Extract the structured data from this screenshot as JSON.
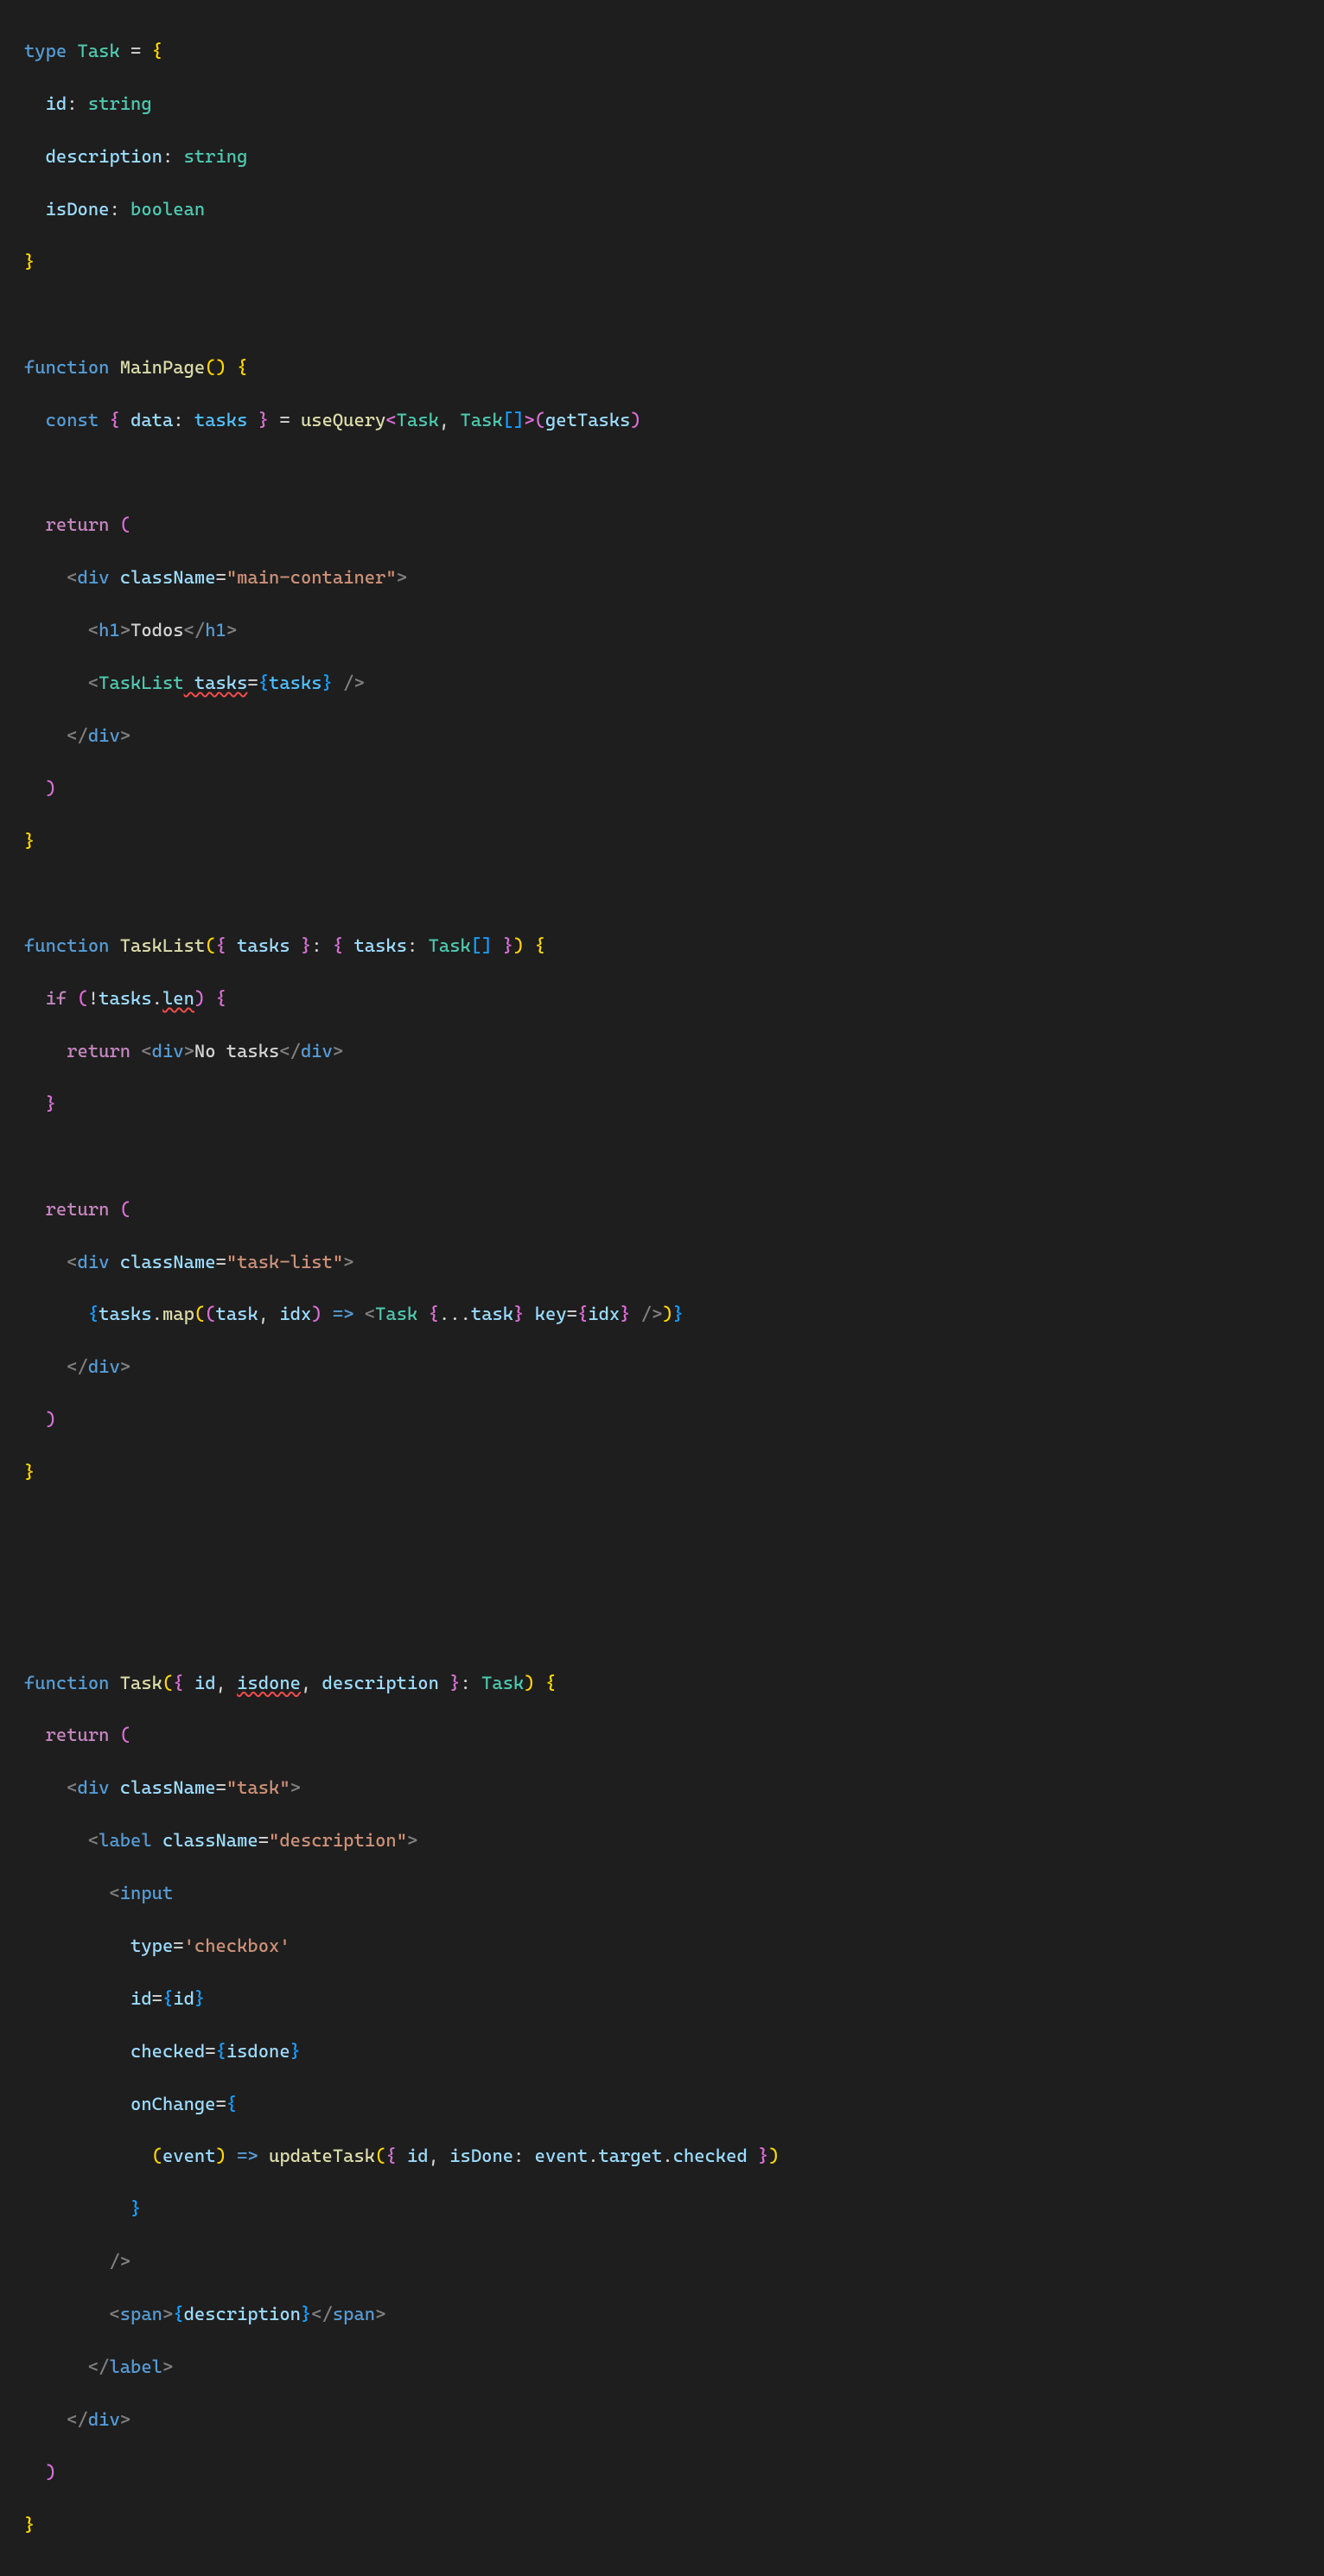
{
  "code": {
    "l1": {
      "type": "type",
      "task": "Task",
      "eq": " = ",
      "ob": "{"
    },
    "l2": {
      "prop": "id",
      "col": ": ",
      "ty": "string"
    },
    "l3": {
      "prop": "description",
      "col": ": ",
      "ty": "string"
    },
    "l4": {
      "prop": "isDone",
      "col": ": ",
      "ty": "boolean"
    },
    "l5": {
      "cb": "}"
    },
    "l7": {
      "fn": "function",
      "name": "MainPage",
      "par": "()",
      "ob": " {"
    },
    "l8": {
      "const": "const",
      "ob": " { ",
      "data": "data",
      "col": ": ",
      "tasks": "tasks",
      "cb": " } ",
      "eq": "= ",
      "uq": "useQuery",
      "lt": "<",
      "task": "Task",
      "c1": ", ",
      "task2": "Task",
      "arr": "[]",
      "gt": ">",
      "op": "(",
      "gt2": "getTasks",
      "cp": ")"
    },
    "l10": {
      "ret": "return",
      "op": " ("
    },
    "l11": {
      "lt": "<",
      "div": "div",
      "cn": " className",
      "eq": "=",
      "s": "\"main-container\"",
      "gt": ">"
    },
    "l12": {
      "lt": "<",
      "h1": "h1",
      "gt": ">",
      "txt": "Todos",
      "lt2": "</",
      "h1b": "h1",
      "gt2": ">"
    },
    "l13": {
      "lt": "<",
      "tl": "TaskList",
      "tasks": " tasks",
      "eq": "=",
      "ob": "{",
      "tv": "tasks",
      "cb": "}",
      "gt": " />"
    },
    "l14": {
      "lt": "</",
      "div": "div",
      "gt": ">"
    },
    "l15": {
      "cp": ")"
    },
    "l16": {
      "cb": "}"
    },
    "l18": {
      "fn": "function",
      "name": "TaskList",
      "op": "(",
      "ob": "{ ",
      "tasks": "tasks",
      "cb": " }",
      "col": ": ",
      "ob2": "{ ",
      "tasks2": "tasks",
      "col2": ": ",
      "task": "Task",
      "arr": "[]",
      "cb2": " }",
      "cp": ")",
      "ob3": " {"
    },
    "l19": {
      "if": "if",
      "op": " (",
      "not": "!",
      "tasks": "tasks",
      "dot": ".",
      "len": "len",
      "cp": ")",
      "ob": " {"
    },
    "l20": {
      "ret": "return",
      "lt": " <",
      "div": "div",
      "gt": ">",
      "txt": "No tasks",
      "lt2": "</",
      "div2": "div",
      "gt2": ">"
    },
    "l21": {
      "cb": "}"
    },
    "l23": {
      "ret": "return",
      "op": " ("
    },
    "l24": {
      "lt": "<",
      "div": "div",
      "cn": " className",
      "eq": "=",
      "s": "\"task-list\"",
      "gt": ">"
    },
    "l25": {
      "ob": "{",
      "tasks": "tasks",
      "dot": ".",
      "map": "map",
      "op": "(",
      "op2": "(",
      "task": "task",
      "c": ", ",
      "idx": "idx",
      "cp": ")",
      "arrow": " => ",
      "lt": "<",
      "taskc": "Task",
      "sp": " ",
      "ob2": "{",
      "spread": "...",
      "taskv": "task",
      "cb2": "}",
      "key": " key",
      "eq": "=",
      "ob3": "{",
      "idx2": "idx",
      "cb3": "}",
      "gt": " />",
      "cp2": ")",
      "cb": "}"
    },
    "l26": {
      "lt": "</",
      "div": "div",
      "gt": ">"
    },
    "l27": {
      "cp": ")"
    },
    "l28": {
      "cb": "}"
    },
    "l31": {
      "fn": "function",
      "name": "Task",
      "op": "(",
      "ob": "{ ",
      "id": "id",
      "c1": ", ",
      "isdone": "isdone",
      "c2": ", ",
      "desc": "description",
      "cb": " }",
      "col": ": ",
      "task": "Task",
      "cp": ")",
      "ob2": " {"
    },
    "l32": {
      "ret": "return",
      "op": " ("
    },
    "l33": {
      "lt": "<",
      "div": "div",
      "cn": " className",
      "eq": "=",
      "s": "\"task\"",
      "gt": ">"
    },
    "l34": {
      "lt": "<",
      "label": "label",
      "cn": " className",
      "eq": "=",
      "s": "\"description\"",
      "gt": ">"
    },
    "l35": {
      "lt": "<",
      "input": "input"
    },
    "l36": {
      "type": "type",
      "eq": "=",
      "s": "'checkbox'"
    },
    "l37": {
      "id": "id",
      "eq": "=",
      "ob": "{",
      "idv": "id",
      "cb": "}"
    },
    "l38": {
      "checked": "checked",
      "eq": "=",
      "ob": "{",
      "isdone": "isdone",
      "cb": "}"
    },
    "l39": {
      "onChange": "onChange",
      "eq": "=",
      "ob": "{"
    },
    "l40": {
      "op": "(",
      "event": "event",
      "cp": ")",
      "arrow": " => ",
      "fn": "updateTask",
      "op2": "(",
      "ob": "{ ",
      "id": "id",
      "c": ", ",
      "isDone": "isDone",
      "col": ": ",
      "event2": "event",
      "d1": ".",
      "target": "target",
      "d2": ".",
      "checked": "checked",
      "cb": " }",
      "cp2": ")"
    },
    "l41": {
      "cb": "}"
    },
    "l42": {
      "gt": "/>"
    },
    "l43": {
      "lt": "<",
      "span": "span",
      "gt": ">",
      "ob": "{",
      "desc": "description",
      "cb": "}",
      "lt2": "</",
      "span2": "span",
      "gt2": ">"
    },
    "l44": {
      "lt": "</",
      "label": "label",
      "gt": ">"
    },
    "l45": {
      "lt": "</",
      "div": "div",
      "gt": ">"
    },
    "l46": {
      "cp": ")"
    },
    "l47": {
      "cb": "}"
    }
  }
}
